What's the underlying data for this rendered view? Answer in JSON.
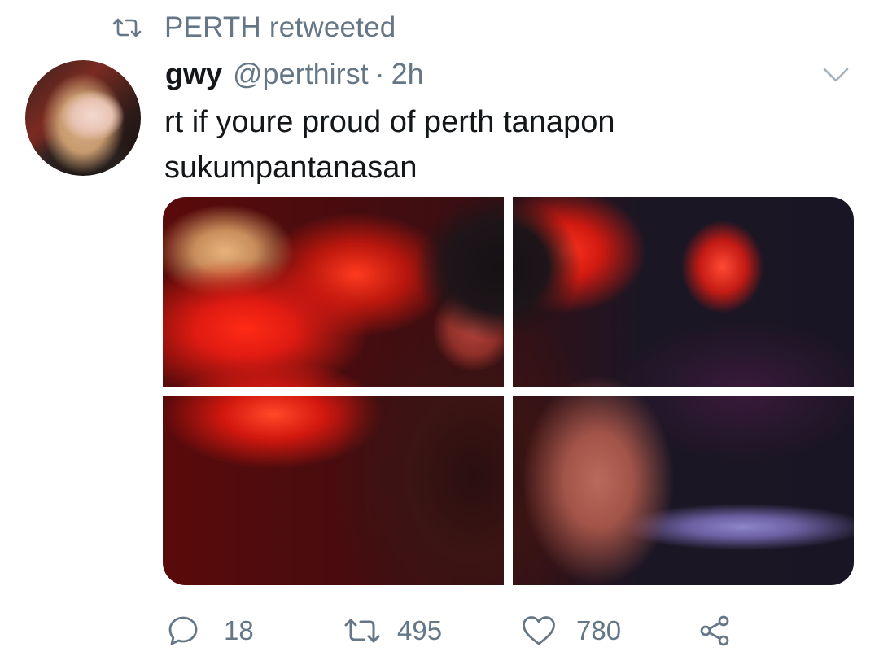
{
  "retweet_context": {
    "text": "PERTH retweeted",
    "icon": "retweet-icon"
  },
  "tweet": {
    "author": {
      "name": "gwy",
      "handle": "@perthirst"
    },
    "separator": "·",
    "time": "2h",
    "text": "rt if youre proud of perth tanapon sukumpantanasan",
    "media": {
      "count": 4,
      "description_icons": [
        "photo-tile"
      ]
    }
  },
  "actions": {
    "reply": {
      "icon": "reply-bubble-icon",
      "count": "18"
    },
    "retweet": {
      "icon": "retweet-icon",
      "count": "495"
    },
    "like": {
      "icon": "heart-icon",
      "count": "780"
    },
    "share": {
      "icon": "share-icon"
    }
  },
  "colors": {
    "muted": "#657786",
    "text": "#14171a",
    "background": "#ffffff"
  }
}
